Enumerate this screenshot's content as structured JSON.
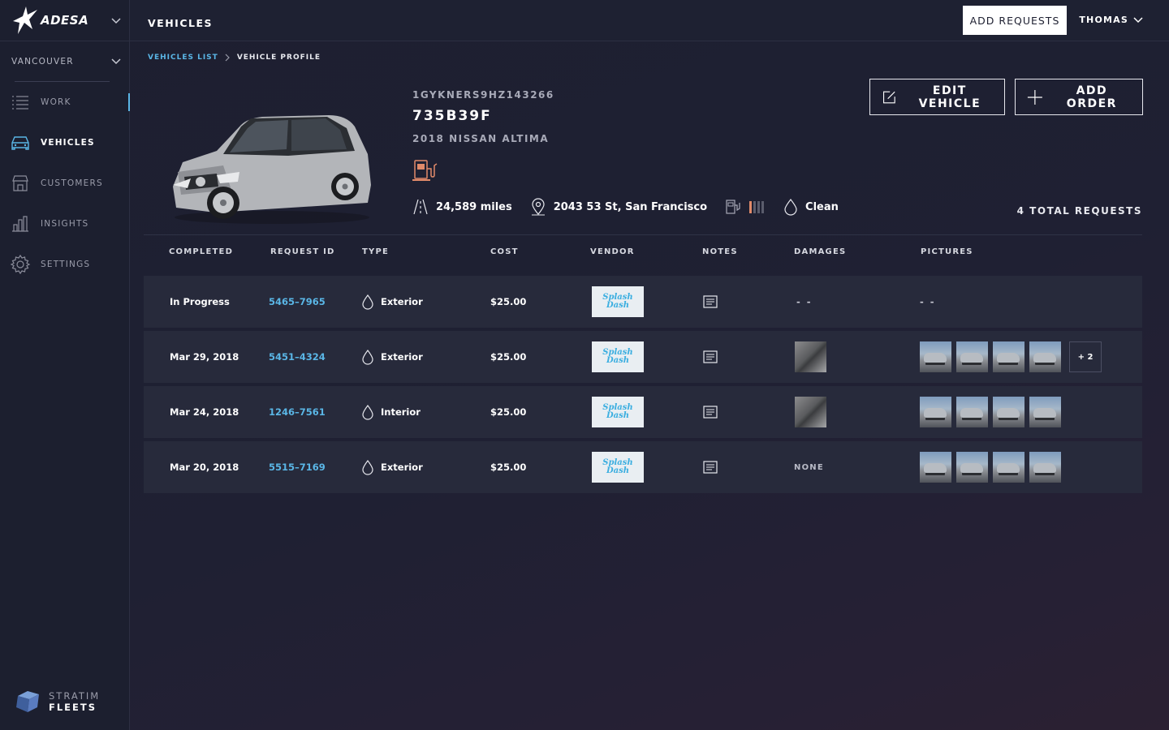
{
  "sidebar": {
    "brand": "ADESA",
    "location": "VANCOUVER",
    "items": [
      {
        "label": "WORK",
        "icon": "list-icon"
      },
      {
        "label": "VEHICLES",
        "icon": "car-icon"
      },
      {
        "label": "CUSTOMERS",
        "icon": "store-icon"
      },
      {
        "label": "INSIGHTS",
        "icon": "bar-chart-icon"
      },
      {
        "label": "SETTINGS",
        "icon": "gear-icon"
      }
    ],
    "footer_brand_top": "STRATIM",
    "footer_brand_bottom": "FLEETS"
  },
  "topbar": {
    "title": "VEHICLES",
    "add_requests_label": "ADD REQUESTS",
    "user_name": "THOMAS"
  },
  "breadcrumb": {
    "link": "VEHICLES LIST",
    "current": "VEHICLE PROFILE"
  },
  "vehicle": {
    "vin": "1GYKNERS9HZ143266",
    "plate": "735B39F",
    "model": "2018 NISSAN ALTIMA",
    "mileage": "24,589 miles",
    "location": "2043 53 St, San Francisco",
    "fuel_level_bars_on": 1,
    "fuel_level_bars_total": 4,
    "cleanliness": "Clean",
    "accent_color": "#e08a6a"
  },
  "actions": {
    "edit_label": "EDIT VEHICLE",
    "add_order_label": "ADD ORDER"
  },
  "total_requests": "4 TOTAL REQUESTS",
  "table": {
    "headers": [
      "COMPLETED",
      "REQUEST ID",
      "TYPE",
      "COST",
      "VENDOR",
      "NOTES",
      "DAMAGES",
      "PICTURES"
    ],
    "rows": [
      {
        "completed": "In Progress",
        "request_id": "5465–7965",
        "type": "Exterior",
        "cost": "$25.00",
        "vendor": "Splash Dash",
        "damages": "- -",
        "pictures_text": "- -"
      },
      {
        "completed": "Mar 29, 2018",
        "request_id": "5451–4324",
        "type": "Exterior",
        "cost": "$25.00",
        "vendor": "Splash Dash",
        "more_pictures": "+ 2"
      },
      {
        "completed": "Mar 24, 2018",
        "request_id": "1246–7561",
        "type": "Interior",
        "cost": "$25.00",
        "vendor": "Splash Dash"
      },
      {
        "completed": "Mar 20, 2018",
        "request_id": "5515–7169",
        "type": "Exterior",
        "cost": "$25.00",
        "vendor": "Splash Dash",
        "damages": "NONE"
      }
    ]
  },
  "colors": {
    "link": "#5ab6e6",
    "row_bg": "#272a3b",
    "sidebar_bg": "#1c1f2f"
  }
}
